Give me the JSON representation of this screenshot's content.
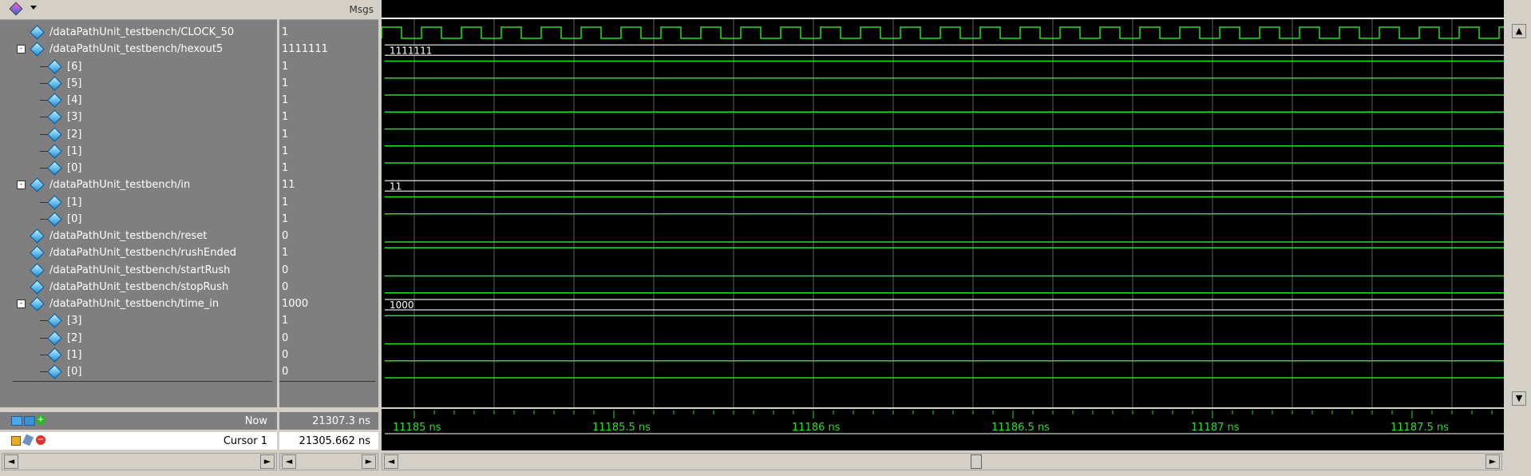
{
  "header": {
    "msgs_label": "Msgs"
  },
  "signals": [
    {
      "name": "/dataPathUnit_testbench/CLOCK_50",
      "value": "1",
      "indent": 0,
      "toggle": "",
      "wave": "clock"
    },
    {
      "name": "/dataPathUnit_testbench/hexout5",
      "value": "1111111",
      "indent": 0,
      "toggle": "-",
      "wave": "bus",
      "bus_label": "1111111"
    },
    {
      "name": "[6]",
      "value": "1",
      "indent": 1,
      "toggle": "",
      "wave": "high"
    },
    {
      "name": "[5]",
      "value": "1",
      "indent": 1,
      "toggle": "",
      "wave": "high"
    },
    {
      "name": "[4]",
      "value": "1",
      "indent": 1,
      "toggle": "",
      "wave": "high"
    },
    {
      "name": "[3]",
      "value": "1",
      "indent": 1,
      "toggle": "",
      "wave": "high"
    },
    {
      "name": "[2]",
      "value": "1",
      "indent": 1,
      "toggle": "",
      "wave": "high"
    },
    {
      "name": "[1]",
      "value": "1",
      "indent": 1,
      "toggle": "",
      "wave": "high"
    },
    {
      "name": "[0]",
      "value": "1",
      "indent": 1,
      "toggle": "",
      "wave": "high"
    },
    {
      "name": "/dataPathUnit_testbench/in",
      "value": "11",
      "indent": 0,
      "toggle": "-",
      "wave": "bus",
      "bus_label": "11"
    },
    {
      "name": "[1]",
      "value": "1",
      "indent": 1,
      "toggle": "",
      "wave": "high"
    },
    {
      "name": "[0]",
      "value": "1",
      "indent": 1,
      "toggle": "",
      "wave": "high"
    },
    {
      "name": "/dataPathUnit_testbench/reset",
      "value": "0",
      "indent": 0,
      "toggle": "",
      "wave": "low"
    },
    {
      "name": "/dataPathUnit_testbench/rushEnded",
      "value": "1",
      "indent": 0,
      "toggle": "",
      "wave": "high"
    },
    {
      "name": "/dataPathUnit_testbench/startRush",
      "value": "0",
      "indent": 0,
      "toggle": "",
      "wave": "low"
    },
    {
      "name": "/dataPathUnit_testbench/stopRush",
      "value": "0",
      "indent": 0,
      "toggle": "",
      "wave": "low"
    },
    {
      "name": "/dataPathUnit_testbench/time_in",
      "value": "1000",
      "indent": 0,
      "toggle": "-",
      "wave": "bus",
      "bus_label": "1000"
    },
    {
      "name": "[3]",
      "value": "1",
      "indent": 1,
      "toggle": "",
      "wave": "high"
    },
    {
      "name": "[2]",
      "value": "0",
      "indent": 1,
      "toggle": "",
      "wave": "low"
    },
    {
      "name": "[1]",
      "value": "0",
      "indent": 1,
      "toggle": "",
      "wave": "low"
    },
    {
      "name": "[0]",
      "value": "0",
      "indent": 1,
      "toggle": "",
      "wave": "low"
    }
  ],
  "footer": {
    "now_label": "Now",
    "now_value": "21307.3 ns",
    "cursor_label": "Cursor 1",
    "cursor_value": "21305.662 ns"
  },
  "timeline": {
    "ticks": [
      "11185 ns",
      "11185.5 ns",
      "11186 ns",
      "11186.5 ns",
      "11187 ns",
      "11187.5 ns"
    ]
  },
  "colors": {
    "wave": "#22e022",
    "background": "#000000",
    "pane": "#7f7f7f"
  },
  "icons": {
    "toolbar": "wave-window-icon",
    "signal": "diamond-signal-icon"
  }
}
